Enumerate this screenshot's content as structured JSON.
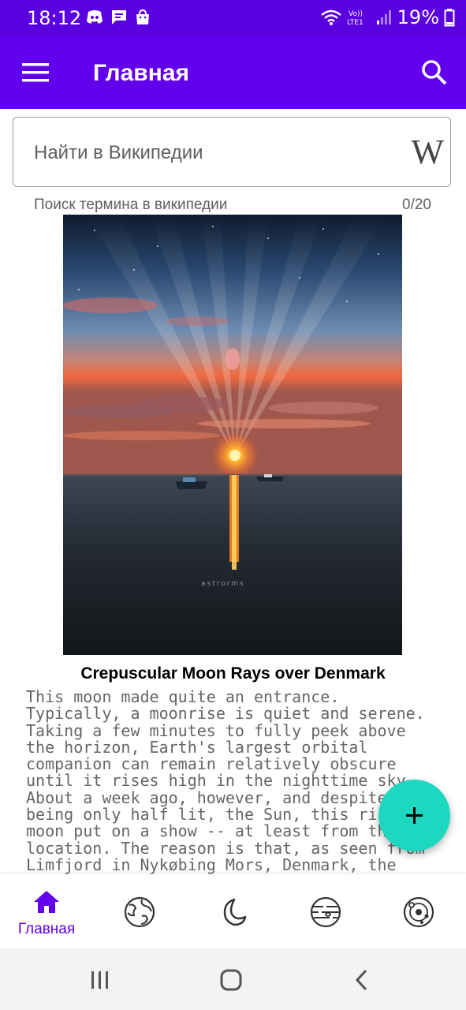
{
  "status_bar": {
    "time": "18:12",
    "battery": "19%",
    "icons": [
      "discord-icon",
      "message-icon",
      "shopping-bag-icon",
      "wifi-icon",
      "volte-icon",
      "signal-icon",
      "battery-icon"
    ],
    "network_label": "Vo)) LTE1"
  },
  "app_bar": {
    "title": "Главная",
    "icons": [
      "menu-icon",
      "search-icon"
    ],
    "color": "#6200ee"
  },
  "search": {
    "placeholder": "Найти в Википедии",
    "helper_text": "Поиск термина в википедии",
    "counter": "0/20",
    "logo": "W"
  },
  "apod": {
    "title": "Crepuscular Moon Rays over Denmark",
    "explanation": "This moon made quite an entrance. Typically, a moonrise is quiet and serene.  Taking a few minutes to fully peek above the horizon, Earth's largest orbital companion can remain relatively obscure until it rises high in the nighttime sky. About a week ago, however, and despite being only half lit, the Sun, this rising moon put on a show -- at least from this location. The reason is that, as seen from Limfjord in Nykøbing Mors, Denmark, the moon rose below",
    "watermark": "astrorms"
  },
  "fab": {
    "icon": "plus-icon",
    "color": "#1ed7c1"
  },
  "bottom_nav": {
    "items": [
      {
        "label": "Главная",
        "icon": "home-icon",
        "active": true
      },
      {
        "label": "",
        "icon": "earth-icon",
        "active": false
      },
      {
        "label": "",
        "icon": "moon-icon",
        "active": false
      },
      {
        "label": "",
        "icon": "planet-icon",
        "active": false
      },
      {
        "label": "",
        "icon": "solar-system-icon",
        "active": false
      }
    ]
  },
  "system_nav": {
    "icons": [
      "recents-icon",
      "home-button-icon",
      "back-icon"
    ]
  }
}
